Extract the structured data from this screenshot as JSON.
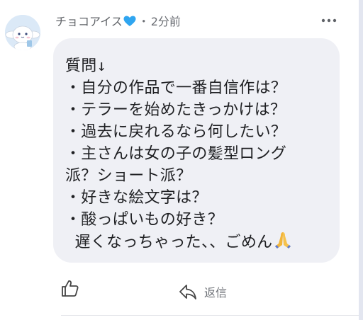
{
  "comment": {
    "author": "チョコアイス",
    "author_emoji": "blue-heart-icon",
    "separator": "・",
    "time": "2分前",
    "body": "質問↓\n・自分の作品で一番自信作は？\n・テラーを始めたきっかけは？\n・過去に戻れるなら何したい？\n・主さんは女の子の髪型ロング\n派？ショート派？\n・好きな絵文字は？\n・酸っぱいもの好き？\n 遅くなっちゃった、、ごめん",
    "body_emoji": "folded-hands-icon",
    "bubble_color": "#eff0f5"
  },
  "actions": {
    "like_icon": "thumbs-up-icon",
    "reply_icon": "reply-arrow-icon",
    "reply_label": "返信"
  }
}
